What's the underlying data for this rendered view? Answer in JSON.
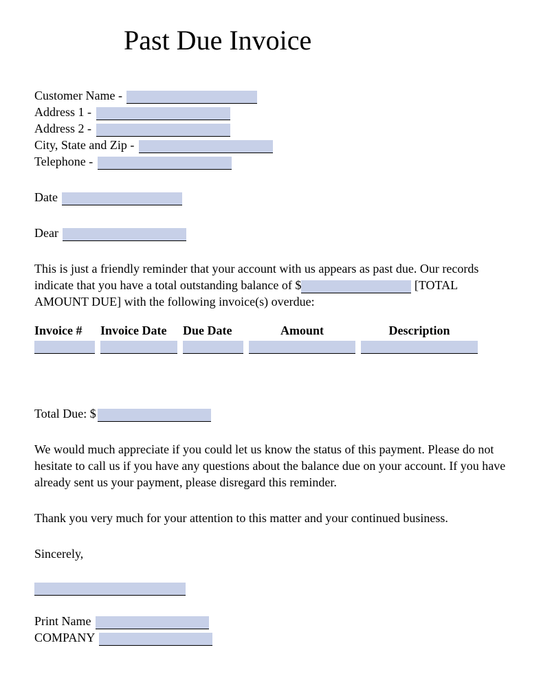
{
  "title": "Past Due Invoice",
  "customer": {
    "name_label": "Customer Name -",
    "address1_label": "Address 1 -",
    "address2_label": "Address 2 -",
    "citystatezip_label": "City, State and Zip -",
    "telephone_label": "Telephone -"
  },
  "date_label": "Date",
  "dear_label": "Dear",
  "body1_pre": "This is just a friendly reminder that your account with us appears as past due. Our records indicate that you have a total outstanding balance of $",
  "body1_post": " [TOTAL AMOUNT DUE] with the following invoice(s) overdue:",
  "table": {
    "headers": {
      "invoice_num": "Invoice #",
      "invoice_date": "Invoice Date",
      "due_date": "Due Date",
      "amount": "Amount",
      "description": "Description"
    }
  },
  "total_due_label": "Total Due: $",
  "body2": "We would much appreciate if you could let us know the status of this payment. Please do not hesitate to call us if you have any questions about the balance due on your account. If you have already sent us your payment, please disregard this reminder.",
  "body3": "Thank you very much for your attention to this matter and your continued business.",
  "sincerely": "Sincerely,",
  "print_name_label": "Print Name",
  "company_label": "COMPANY"
}
